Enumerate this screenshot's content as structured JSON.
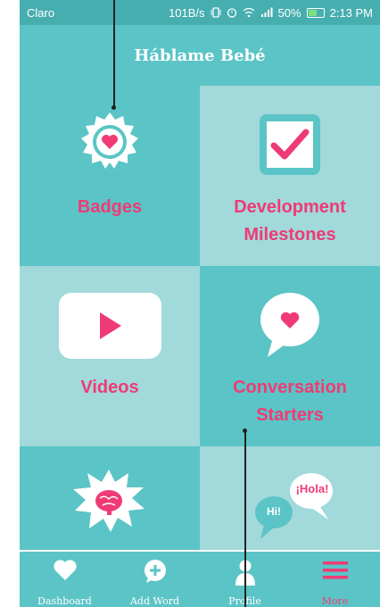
{
  "status_bar": {
    "carrier": "Claro",
    "indicators": "101B/s",
    "battery": "50%",
    "time": "2:13 PM"
  },
  "header": {
    "title": "Háblame Bebé"
  },
  "tiles": [
    {
      "label_line1": "Badges",
      "label_line2": ""
    },
    {
      "label_line1": "Development",
      "label_line2": "Milestones"
    },
    {
      "label_line1": "Videos",
      "label_line2": ""
    },
    {
      "label_line1": "Conversation",
      "label_line2": "Starters"
    }
  ],
  "bubbles": {
    "hola": "¡Hola!",
    "hi": "Hi!"
  },
  "nav": [
    {
      "label": "Dashboard",
      "icon": "heart-icon"
    },
    {
      "label": "Add Word",
      "icon": "plus-chat-icon"
    },
    {
      "label": "Profile",
      "icon": "person-icon"
    },
    {
      "label": "More",
      "icon": "menu-icon"
    }
  ],
  "colors": {
    "teal": "#5bc4c6",
    "light_teal": "#a2d9db",
    "pink": "#ef3b75"
  }
}
